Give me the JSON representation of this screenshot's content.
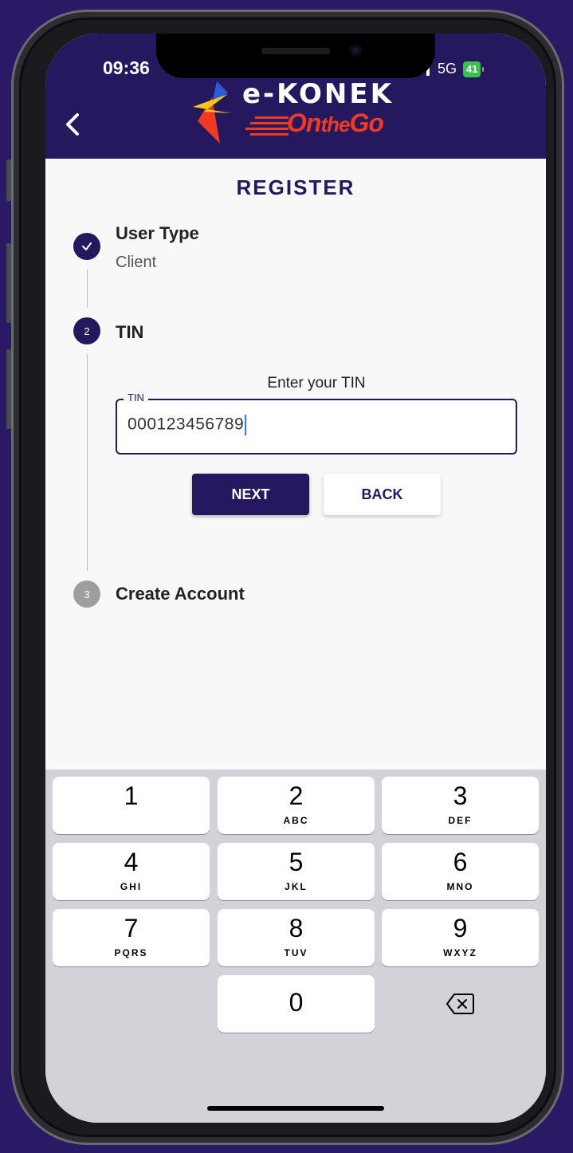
{
  "status_bar": {
    "time": "09:36",
    "network": "5G",
    "battery": "41"
  },
  "header": {
    "logo_title": "e-KONEK",
    "logo_subtitle": "On the Go",
    "accent_color": "#26185f",
    "logo_red": "#ef3b24",
    "logo_yellow": "#f5c518",
    "logo_blue": "#2d5bd6"
  },
  "page": {
    "title": "REGISTER"
  },
  "steps": [
    {
      "number": "✓",
      "title": "User Type",
      "subtitle": "Client",
      "state": "complete"
    },
    {
      "number": "2",
      "title": "TIN",
      "subtitle": "",
      "state": "active"
    },
    {
      "number": "3",
      "title": "Create Account",
      "subtitle": "",
      "state": "pending"
    }
  ],
  "tin_step": {
    "prompt": "Enter your TIN",
    "field_label": "TIN",
    "field_value": "000123456789",
    "next_label": "NEXT",
    "back_label": "BACK"
  },
  "keyboard": {
    "keys": [
      {
        "number": "1",
        "letters": ""
      },
      {
        "number": "2",
        "letters": "ABC"
      },
      {
        "number": "3",
        "letters": "DEF"
      },
      {
        "number": "4",
        "letters": "GHI"
      },
      {
        "number": "5",
        "letters": "JKL"
      },
      {
        "number": "6",
        "letters": "MNO"
      },
      {
        "number": "7",
        "letters": "PQRS"
      },
      {
        "number": "8",
        "letters": "TUV"
      },
      {
        "number": "9",
        "letters": "WXYZ"
      },
      {
        "number": "0",
        "letters": ""
      }
    ],
    "delete_icon": "backspace-icon"
  }
}
